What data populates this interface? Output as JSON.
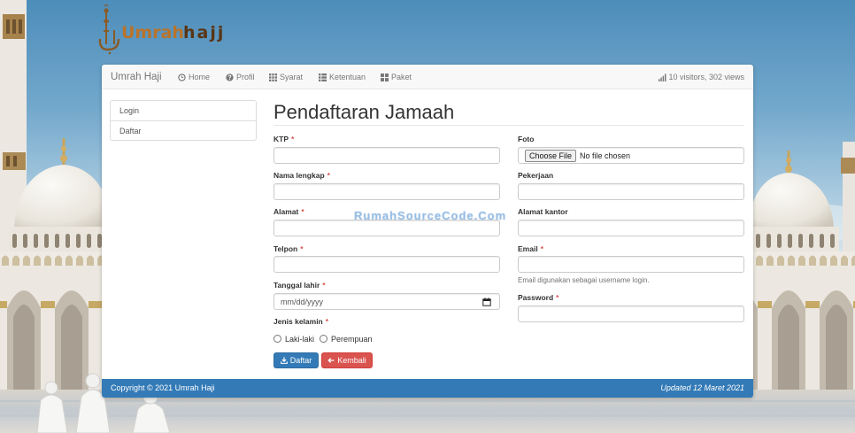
{
  "logo": {
    "part1": "Umrah",
    "part2": "hajj"
  },
  "navbar": {
    "brand": "Umrah Haji",
    "items": [
      {
        "label": "Home",
        "icon": "clock-icon"
      },
      {
        "label": "Profil",
        "icon": "question-circle-icon"
      },
      {
        "label": "Syarat",
        "icon": "th-icon"
      },
      {
        "label": "Ketentuan",
        "icon": "list-icon"
      },
      {
        "label": "Paket",
        "icon": "th-large-icon"
      }
    ],
    "stats": {
      "icon": "signal-icon",
      "text": "10 visitors, 302 views"
    }
  },
  "sidebar": {
    "items": [
      {
        "label": "Login"
      },
      {
        "label": "Daftar"
      }
    ]
  },
  "page_title": "Pendaftaran Jamaah",
  "form": {
    "ktp": {
      "label": "KTP",
      "required": "*"
    },
    "nama_lengkap": {
      "label": "Nama lengkap",
      "required": "*"
    },
    "alamat": {
      "label": "Alamat",
      "required": "*"
    },
    "telpon": {
      "label": "Telpon",
      "required": "*"
    },
    "tanggal_lahir": {
      "label": "Tanggal lahir",
      "required": "*",
      "placeholder": "mm/dd/yyyy",
      "icon": "calendar-icon"
    },
    "jenis_kelamin": {
      "label": "Jenis kelamin",
      "required": "*",
      "options": [
        "Laki-laki",
        "Perempuan"
      ]
    },
    "foto": {
      "label": "Foto",
      "button": "Choose File",
      "status": "No file chosen"
    },
    "pekerjaan": {
      "label": "Pekerjaan"
    },
    "alamat_kantor": {
      "label": "Alamat kantor"
    },
    "email": {
      "label": "Email",
      "required": "*",
      "help": "Email digunakan sebagai username login."
    },
    "password": {
      "label": "Password",
      "required": "*"
    },
    "submit_button": {
      "label": "Daftar",
      "icon": "download-icon"
    },
    "back_button": {
      "label": "Kembali",
      "icon": "arrow-left-icon"
    }
  },
  "watermark": "RumahSourceCode.Com",
  "footer": {
    "copyright": "Copyright © 2021 Umrah Haji",
    "updated": "Updated 12 Maret 2021"
  },
  "colors": {
    "primary": "#337ab7",
    "danger": "#d9534f",
    "required": "#d9534f",
    "logo_accent": "#b9732a",
    "logo_dark": "#5a3514",
    "footer": "#337ab7"
  }
}
